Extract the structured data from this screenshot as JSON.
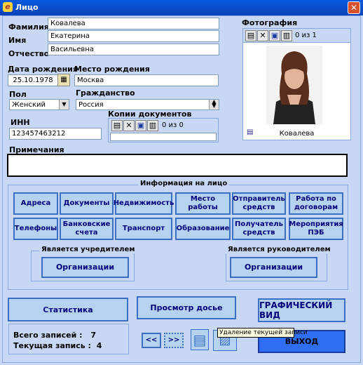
{
  "window": {
    "title": "Лицо",
    "close_glyph": "✕"
  },
  "person": {
    "surname_label": "Фамилия",
    "surname": "Ковалева",
    "name_label": "Имя",
    "name": "Екатерина",
    "patronymic_label": "Отчество",
    "patronymic": "Васильевна",
    "birthdate_label": "Дата рождения",
    "birthdate": "25.10.1978",
    "birthplace_label": "Место рождения",
    "birthplace": "Москва",
    "sex_label": "Пол",
    "sex": "Женский",
    "citizenship_label": "Гражданство",
    "citizenship": "Россия",
    "inn_label": "ИНН",
    "inn": "123457463212",
    "notes_label": "Примечания",
    "notes": ""
  },
  "photo": {
    "label": "Фотография",
    "counter": "0 из 1",
    "caption": "Ковалева"
  },
  "copies": {
    "label": "Копии документов",
    "counter": "0 из 0"
  },
  "info": {
    "title": "Информация на лицо",
    "buttons_row1": [
      "Адреса",
      "Документы",
      "Недвижимость",
      "Место работы",
      "Отправитель средств",
      "Работа по договорам"
    ],
    "buttons_row2": [
      "Телефоны",
      "Банковские счета",
      "Транспорт",
      "Образование",
      "Получатель средств",
      "Мероприятия ПЭБ"
    ],
    "founder_title": "Является учредителем",
    "founder_button": "Организации",
    "head_title": "Является руководителем",
    "head_button": "Организации"
  },
  "actions": {
    "stats": "Статистика",
    "dossier": "Просмотр досье",
    "graphic": "ГРАФИЧЕСКИЙ ВИД",
    "exit": "ВЫХОД",
    "prev": "<<",
    "next": ">>",
    "tooltip": "Удаление текущей записи"
  },
  "status": {
    "total_label": "Всего записей :",
    "total": "7",
    "current_label": "Текущая запись :",
    "current": "4"
  },
  "colors": {
    "accent": "#0a5be0",
    "button_bg": "#b5d3f0",
    "button_border": "#3a6fc4",
    "exit_bg": "#2f6df3",
    "panel_bg": "#c8d8f4"
  }
}
